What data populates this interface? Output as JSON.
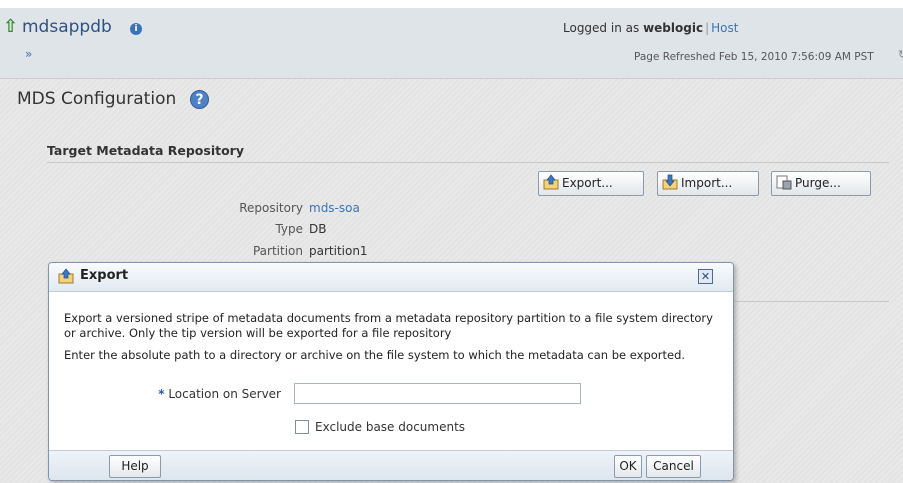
{
  "header": {
    "app_name": "mdsappdb",
    "nav_arrows": "»",
    "logged_in_prefix": "Logged in as",
    "user": "weblogic",
    "separator": "|",
    "host_link": "Host",
    "page_refreshed": "Page Refreshed Feb 15, 2010 7:56:09 AM PST"
  },
  "page": {
    "title": "MDS Configuration",
    "section_title": "Target Metadata Repository"
  },
  "toolbar": {
    "export_label": "Export...",
    "import_label": "Import...",
    "purge_label": "Purge..."
  },
  "repository": {
    "repository_label": "Repository",
    "repository_value": "mds-soa",
    "type_label": "Type",
    "type_value": "DB",
    "partition_label": "Partition",
    "partition_value": "partition1"
  },
  "dialog": {
    "title": "Export",
    "description1": "Export a versioned stripe of metadata documents from a metadata repository partition to a file system directory or archive. Only the tip version will be exported for a file repository",
    "description2": "Enter the absolute path to a directory or archive on the file system to which the metadata can be exported.",
    "required_marker": "*",
    "location_label": "Location on Server",
    "location_value": "",
    "exclude_label": "Exclude base documents",
    "exclude_checked": false,
    "help_label": "Help",
    "ok_label": "OK",
    "cancel_label": "Cancel"
  }
}
